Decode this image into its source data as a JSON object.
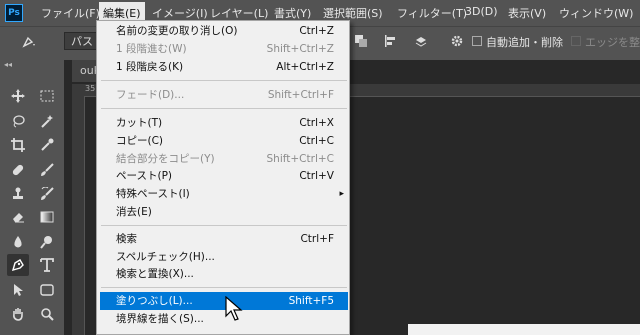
{
  "app": {
    "logo": "Ps"
  },
  "menubar": {
    "items": [
      {
        "label": "ファイル(F)"
      },
      {
        "label": "編集(E)"
      },
      {
        "label": "イメージ(I)"
      },
      {
        "label": "レイヤー(L)"
      },
      {
        "label": "書式(Y)"
      },
      {
        "label": "選択範囲(S)"
      },
      {
        "label": "フィルター(T)"
      },
      {
        "label": "3D(D)"
      },
      {
        "label": "表示(V)"
      },
      {
        "label": "ウィンドウ(W)"
      }
    ]
  },
  "options_bar": {
    "mode_value": "パス",
    "auto_add_delete": "自動追加・削除",
    "align_edges": "エッジを整列"
  },
  "document": {
    "tab_label": "ouk",
    "ruler_label": "35"
  },
  "edit_menu": {
    "items": [
      {
        "label": "名前の変更の取り消し(O)",
        "shortcut": "Ctrl+Z"
      },
      {
        "label": "1 段階進む(W)",
        "shortcut": "Shift+Ctrl+Z"
      },
      {
        "label": "1 段階戻る(K)",
        "shortcut": "Alt+Ctrl+Z"
      },
      {
        "label": "フェード(D)...",
        "shortcut": "Shift+Ctrl+F"
      },
      {
        "label": "カット(T)",
        "shortcut": "Ctrl+X"
      },
      {
        "label": "コピー(C)",
        "shortcut": "Ctrl+C"
      },
      {
        "label": "結合部分をコピー(Y)",
        "shortcut": "Shift+Ctrl+C"
      },
      {
        "label": "ペースト(P)",
        "shortcut": "Ctrl+V"
      },
      {
        "label": "特殊ペースト(I)",
        "submenu_arrow": "▸"
      },
      {
        "label": "消去(E)"
      },
      {
        "label": "検索",
        "shortcut": "Ctrl+F"
      },
      {
        "label": "スペルチェック(H)..."
      },
      {
        "label": "検索と置換(X)..."
      },
      {
        "label": "塗りつぶし(L)...",
        "shortcut": "Shift+F5"
      },
      {
        "label": "境界線を描く(S)..."
      }
    ]
  },
  "colors": {
    "highlight": "#0078d7",
    "menubar": "#535353",
    "workspace": "#282828",
    "menu_bg": "#f0f0f0"
  }
}
